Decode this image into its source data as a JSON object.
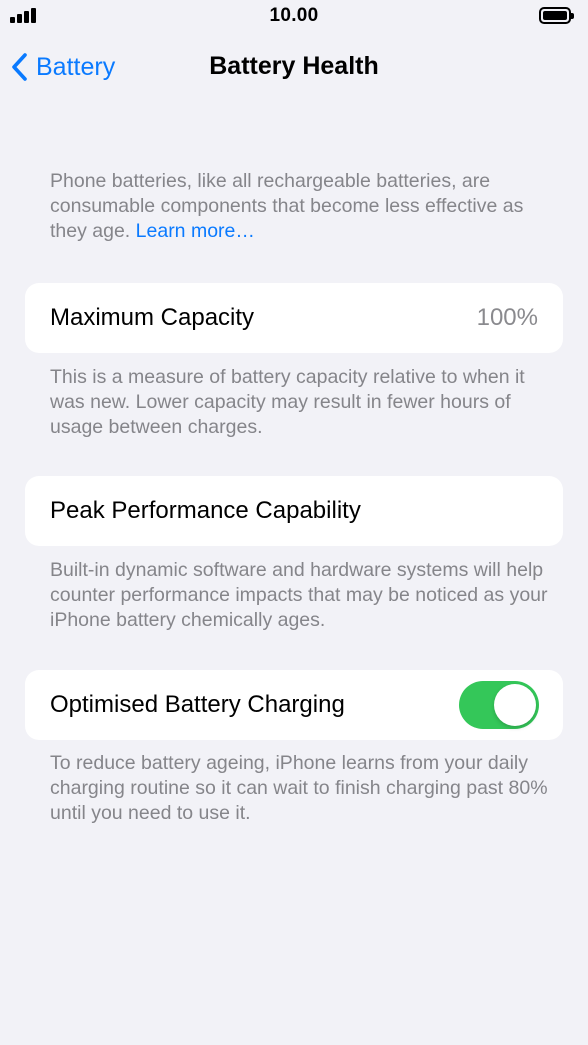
{
  "status_bar": {
    "time": "10.00",
    "signal_icon": "cellular-signal-icon",
    "battery_icon": "battery-full-icon",
    "battery_level": 1.0
  },
  "nav": {
    "back_label": "Battery",
    "back_icon": "chevron-left-icon",
    "title": "Battery Health"
  },
  "intro": {
    "text": "Phone batteries, like all rechargeable batteries, are consumable components that become less effective as they age. ",
    "link": "Learn more…"
  },
  "maximum_capacity": {
    "label": "Maximum Capacity",
    "value": "100%",
    "footer": "This is a measure of battery capacity relative to when it was new. Lower capacity may result in fewer hours of usage between charges."
  },
  "peak_performance": {
    "label": "Peak Performance Capability",
    "footer": "Built-in dynamic software and hardware systems will help counter performance impacts that may be noticed as your iPhone battery chemically ages."
  },
  "optimised_charging": {
    "label": "Optimised Battery Charging",
    "enabled": true,
    "footer": "To reduce battery ageing, iPhone learns from your daily charging routine so it can wait to finish charging past 80% until you need to use it."
  },
  "colors": {
    "accent": "#0a7aff",
    "toggle_on": "#34c759",
    "background": "#f2f2f7",
    "secondary_text": "#85858a"
  }
}
